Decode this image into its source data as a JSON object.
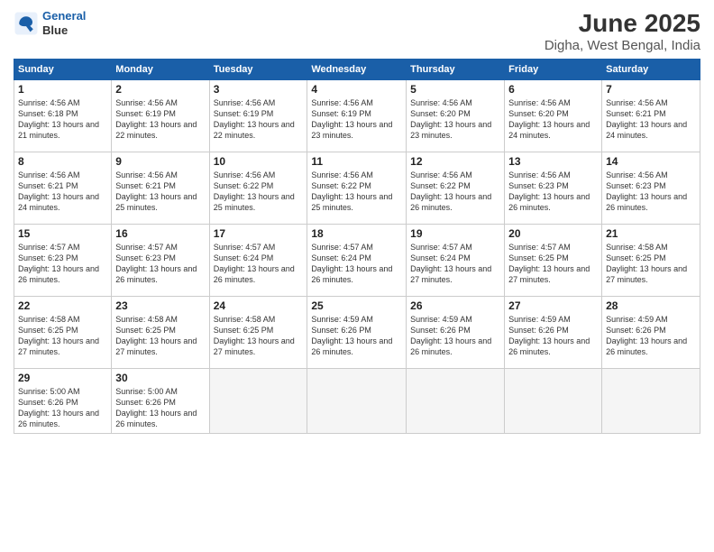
{
  "logo": {
    "line1": "General",
    "line2": "Blue"
  },
  "title": "June 2025",
  "location": "Digha, West Bengal, India",
  "headers": [
    "Sunday",
    "Monday",
    "Tuesday",
    "Wednesday",
    "Thursday",
    "Friday",
    "Saturday"
  ],
  "weeks": [
    [
      {
        "day": "1",
        "sunrise": "4:56 AM",
        "sunset": "6:18 PM",
        "daylight": "13 hours and 21 minutes."
      },
      {
        "day": "2",
        "sunrise": "4:56 AM",
        "sunset": "6:19 PM",
        "daylight": "13 hours and 22 minutes."
      },
      {
        "day": "3",
        "sunrise": "4:56 AM",
        "sunset": "6:19 PM",
        "daylight": "13 hours and 22 minutes."
      },
      {
        "day": "4",
        "sunrise": "4:56 AM",
        "sunset": "6:19 PM",
        "daylight": "13 hours and 23 minutes."
      },
      {
        "day": "5",
        "sunrise": "4:56 AM",
        "sunset": "6:20 PM",
        "daylight": "13 hours and 23 minutes."
      },
      {
        "day": "6",
        "sunrise": "4:56 AM",
        "sunset": "6:20 PM",
        "daylight": "13 hours and 24 minutes."
      },
      {
        "day": "7",
        "sunrise": "4:56 AM",
        "sunset": "6:21 PM",
        "daylight": "13 hours and 24 minutes."
      }
    ],
    [
      {
        "day": "8",
        "sunrise": "4:56 AM",
        "sunset": "6:21 PM",
        "daylight": "13 hours and 24 minutes."
      },
      {
        "day": "9",
        "sunrise": "4:56 AM",
        "sunset": "6:21 PM",
        "daylight": "13 hours and 25 minutes."
      },
      {
        "day": "10",
        "sunrise": "4:56 AM",
        "sunset": "6:22 PM",
        "daylight": "13 hours and 25 minutes."
      },
      {
        "day": "11",
        "sunrise": "4:56 AM",
        "sunset": "6:22 PM",
        "daylight": "13 hours and 25 minutes."
      },
      {
        "day": "12",
        "sunrise": "4:56 AM",
        "sunset": "6:22 PM",
        "daylight": "13 hours and 26 minutes."
      },
      {
        "day": "13",
        "sunrise": "4:56 AM",
        "sunset": "6:23 PM",
        "daylight": "13 hours and 26 minutes."
      },
      {
        "day": "14",
        "sunrise": "4:56 AM",
        "sunset": "6:23 PM",
        "daylight": "13 hours and 26 minutes."
      }
    ],
    [
      {
        "day": "15",
        "sunrise": "4:57 AM",
        "sunset": "6:23 PM",
        "daylight": "13 hours and 26 minutes."
      },
      {
        "day": "16",
        "sunrise": "4:57 AM",
        "sunset": "6:23 PM",
        "daylight": "13 hours and 26 minutes."
      },
      {
        "day": "17",
        "sunrise": "4:57 AM",
        "sunset": "6:24 PM",
        "daylight": "13 hours and 26 minutes."
      },
      {
        "day": "18",
        "sunrise": "4:57 AM",
        "sunset": "6:24 PM",
        "daylight": "13 hours and 26 minutes."
      },
      {
        "day": "19",
        "sunrise": "4:57 AM",
        "sunset": "6:24 PM",
        "daylight": "13 hours and 27 minutes."
      },
      {
        "day": "20",
        "sunrise": "4:57 AM",
        "sunset": "6:25 PM",
        "daylight": "13 hours and 27 minutes."
      },
      {
        "day": "21",
        "sunrise": "4:58 AM",
        "sunset": "6:25 PM",
        "daylight": "13 hours and 27 minutes."
      }
    ],
    [
      {
        "day": "22",
        "sunrise": "4:58 AM",
        "sunset": "6:25 PM",
        "daylight": "13 hours and 27 minutes."
      },
      {
        "day": "23",
        "sunrise": "4:58 AM",
        "sunset": "6:25 PM",
        "daylight": "13 hours and 27 minutes."
      },
      {
        "day": "24",
        "sunrise": "4:58 AM",
        "sunset": "6:25 PM",
        "daylight": "13 hours and 27 minutes."
      },
      {
        "day": "25",
        "sunrise": "4:59 AM",
        "sunset": "6:26 PM",
        "daylight": "13 hours and 26 minutes."
      },
      {
        "day": "26",
        "sunrise": "4:59 AM",
        "sunset": "6:26 PM",
        "daylight": "13 hours and 26 minutes."
      },
      {
        "day": "27",
        "sunrise": "4:59 AM",
        "sunset": "6:26 PM",
        "daylight": "13 hours and 26 minutes."
      },
      {
        "day": "28",
        "sunrise": "4:59 AM",
        "sunset": "6:26 PM",
        "daylight": "13 hours and 26 minutes."
      }
    ],
    [
      {
        "day": "29",
        "sunrise": "5:00 AM",
        "sunset": "6:26 PM",
        "daylight": "13 hours and 26 minutes."
      },
      {
        "day": "30",
        "sunrise": "5:00 AM",
        "sunset": "6:26 PM",
        "daylight": "13 hours and 26 minutes."
      },
      null,
      null,
      null,
      null,
      null
    ]
  ]
}
